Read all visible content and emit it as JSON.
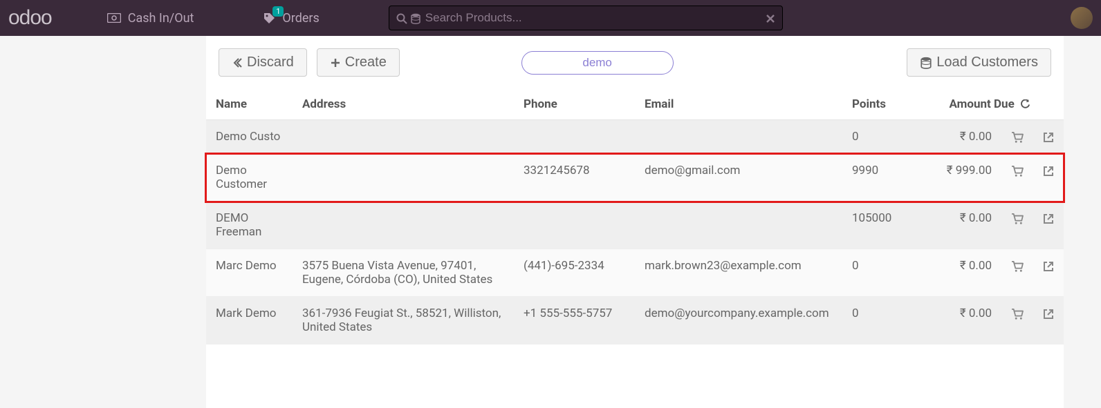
{
  "topbar": {
    "logo": "odoo",
    "cash_label": "Cash In/Out",
    "orders_label": "Orders",
    "orders_badge": "1",
    "search_placeholder": "Search Products..."
  },
  "toolbar": {
    "discard_label": "Discard",
    "create_label": "Create",
    "search_value": "demo",
    "load_label": "Load Customers"
  },
  "table": {
    "headers": {
      "name": "Name",
      "address": "Address",
      "phone": "Phone",
      "email": "Email",
      "points": "Points",
      "amount_due": "Amount Due"
    },
    "rows": [
      {
        "name": "Demo Custo",
        "address": "",
        "phone": "",
        "email": "",
        "points": "0",
        "amount_due": "₹ 0.00",
        "highlight": false
      },
      {
        "name": "Demo Customer",
        "address": "",
        "phone": "3321245678",
        "email": "demo@gmail.com",
        "points": "9990",
        "amount_due": "₹ 999.00",
        "highlight": true
      },
      {
        "name": "DEMO Freeman",
        "address": "",
        "phone": "",
        "email": "",
        "points": "105000",
        "amount_due": "₹ 0.00",
        "highlight": false
      },
      {
        "name": "Marc Demo",
        "address": "3575 Buena Vista Avenue, 97401, Eugene, Córdoba (CO), United States",
        "phone": "(441)-695-2334",
        "email": "mark.brown23@example.com",
        "points": "0",
        "amount_due": "₹ 0.00",
        "highlight": false
      },
      {
        "name": "Mark Demo",
        "address": "361-7936 Feugiat St., 58521, Williston, United States",
        "phone": "+1 555-555-5757",
        "email": "demo@yourcompany.example.com",
        "points": "0",
        "amount_due": "₹ 0.00",
        "highlight": false
      }
    ]
  }
}
